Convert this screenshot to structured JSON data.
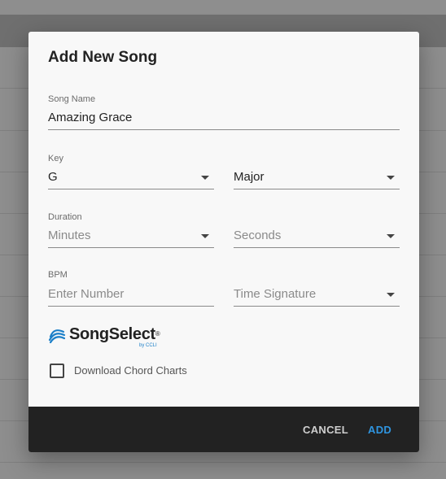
{
  "dialog": {
    "title": "Add New Song",
    "song_name": {
      "label": "Song Name",
      "value": "Amazing Grace"
    },
    "key": {
      "label": "Key",
      "key_value": "G",
      "mode_value": "Major"
    },
    "duration": {
      "label": "Duration",
      "minutes_placeholder": "Minutes",
      "seconds_placeholder": "Seconds"
    },
    "bpm": {
      "label": "BPM",
      "placeholder": "Enter Number",
      "time_signature_placeholder": "Time Signature"
    },
    "songselect": {
      "brand": "SongSelect",
      "trademark": "®",
      "byline": "by CCLI",
      "brand_color": "#1c7fc8"
    },
    "download_chord_charts": {
      "label": "Download Chord Charts",
      "checked": false
    },
    "footer": {
      "cancel_label": "CANCEL",
      "add_label": "ADD",
      "add_color": "#2f95e0"
    },
    "icons": [
      "chevron-down-icon",
      "songselect-logo-icon",
      "checkbox-icon"
    ]
  }
}
